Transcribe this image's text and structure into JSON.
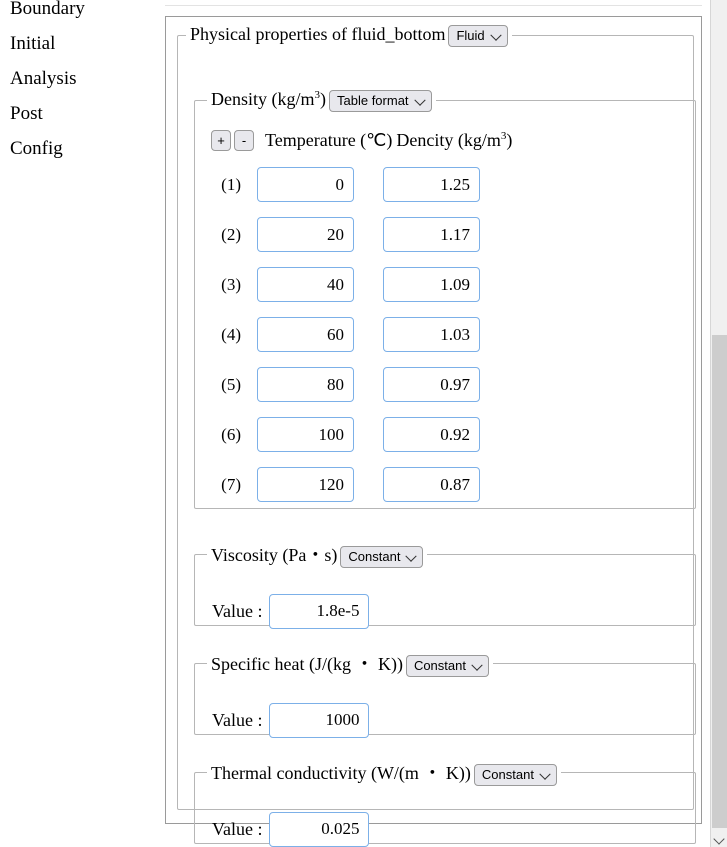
{
  "sidebar": {
    "items": [
      {
        "label": "Boundary"
      },
      {
        "label": "Initial"
      },
      {
        "label": "Analysis"
      },
      {
        "label": "Post"
      },
      {
        "label": "Config"
      }
    ]
  },
  "panel": {
    "legend_text": "Physical properties of fluid_bottom",
    "material_select": "Fluid"
  },
  "density": {
    "legend_prefix": "Density (kg/m",
    "legend_sup": "3",
    "legend_suffix": ")",
    "format_select": "Table format",
    "add_button": "+",
    "remove_button": "-",
    "col_temperature": "Temperature (℃)",
    "col_density_prefix": "Dencity (kg/m",
    "col_density_sup": "3",
    "col_density_suffix": ")",
    "rows": [
      {
        "index": "(1)",
        "temperature": "0",
        "density": "1.25"
      },
      {
        "index": "(2)",
        "temperature": "20",
        "density": "1.17"
      },
      {
        "index": "(3)",
        "temperature": "40",
        "density": "1.09"
      },
      {
        "index": "(4)",
        "temperature": "60",
        "density": "1.03"
      },
      {
        "index": "(5)",
        "temperature": "80",
        "density": "0.97"
      },
      {
        "index": "(6)",
        "temperature": "100",
        "density": "0.92"
      },
      {
        "index": "(7)",
        "temperature": "120",
        "density": "0.87"
      }
    ]
  },
  "viscosity": {
    "legend": "Viscosity (Pa・s)",
    "mode_select": "Constant",
    "value_label": "Value :",
    "value": "1.8e-5"
  },
  "specific_heat": {
    "legend": "Specific heat (J/(kg ・ K))",
    "mode_select": "Constant",
    "value_label": "Value :",
    "value": "1000"
  },
  "thermal_conductivity": {
    "legend": "Thermal conductivity (W/(m ・ K))",
    "mode_select": "Constant",
    "value_label": "Value :",
    "value": "0.025"
  },
  "colors": {
    "input_border": "#7cb0e8",
    "fieldset_border": "#b6b6b6",
    "panel_border": "#9a9a9a",
    "control_bg": "#e8e8ed",
    "scrollbar_thumb": "#cdcdcd"
  }
}
